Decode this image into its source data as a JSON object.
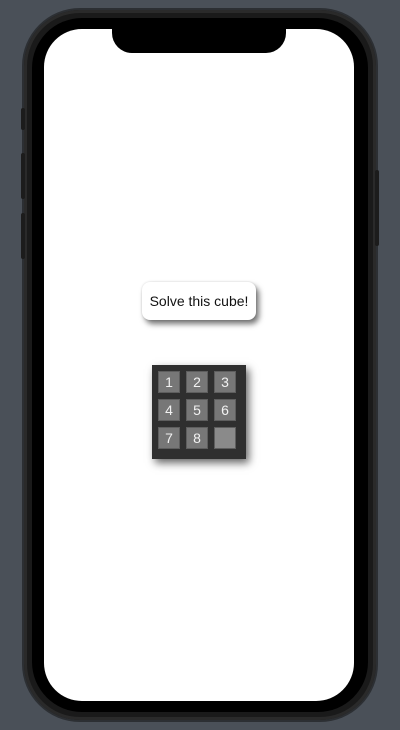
{
  "screen": {
    "prompt_label": "Solve this cube!"
  },
  "puzzle": {
    "tiles": [
      "1",
      "2",
      "3",
      "4",
      "5",
      "6",
      "7",
      "8",
      ""
    ]
  }
}
